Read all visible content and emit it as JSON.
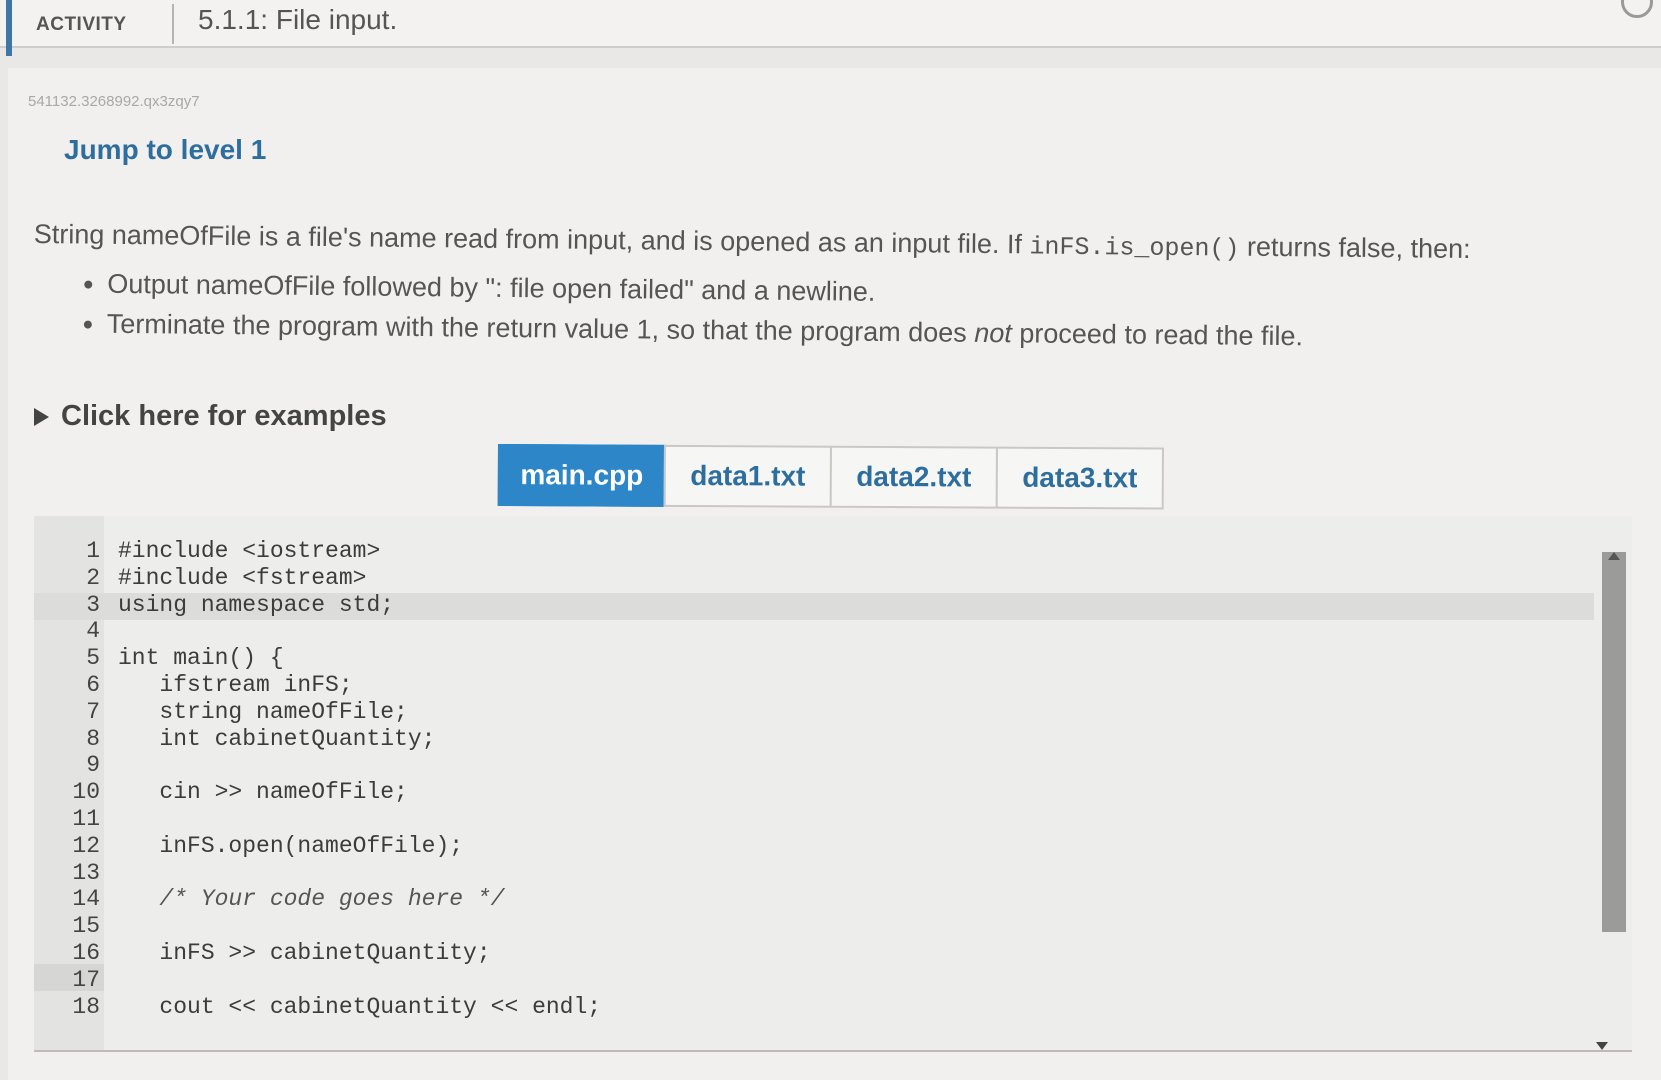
{
  "header": {
    "activity_label": "ACTIVITY",
    "title": "5.1.1: File input."
  },
  "activity_id": "541132.3268992.qx3zqy7",
  "level_link": "Jump to level 1",
  "prompt": {
    "intro_before": "String nameOfFile is a file's name read from input, and is opened as an input file. If ",
    "intro_code": "inFS.is_open()",
    "intro_after": " returns false, then:",
    "bullet1": "Output nameOfFile followed by \": file open failed\" and a newline.",
    "bullet2_before": "Terminate the program with the return value 1, so that the program does ",
    "bullet2_em": "not",
    "bullet2_after": " proceed to read the file."
  },
  "examples_label": "Click here for examples",
  "tabs": [
    {
      "label": "main.cpp",
      "active": true
    },
    {
      "label": "data1.txt",
      "active": false
    },
    {
      "label": "data2.txt",
      "active": false
    },
    {
      "label": "data3.txt",
      "active": false
    }
  ],
  "code": [
    {
      "n": "1",
      "text": "#include <iostream>"
    },
    {
      "n": "2",
      "text": "#include <fstream>"
    },
    {
      "n": "3",
      "text": "using namespace std;"
    },
    {
      "n": "4",
      "text": ""
    },
    {
      "n": "5",
      "text": "int main() {"
    },
    {
      "n": "6",
      "text": "   ifstream inFS;"
    },
    {
      "n": "7",
      "text": "   string nameOfFile;"
    },
    {
      "n": "8",
      "text": "   int cabinetQuantity;"
    },
    {
      "n": "9",
      "text": ""
    },
    {
      "n": "10",
      "text": "   cin >> nameOfFile;"
    },
    {
      "n": "11",
      "text": ""
    },
    {
      "n": "12",
      "text": "   inFS.open(nameOfFile);"
    },
    {
      "n": "13",
      "text": ""
    },
    {
      "n": "14",
      "text": "   /* Your code goes here */"
    },
    {
      "n": "15",
      "text": ""
    },
    {
      "n": "16",
      "text": "   inFS >> cabinetQuantity;"
    },
    {
      "n": "17",
      "text": ""
    },
    {
      "n": "18",
      "text": "   cout << cabinetQuantity << endl;"
    }
  ]
}
